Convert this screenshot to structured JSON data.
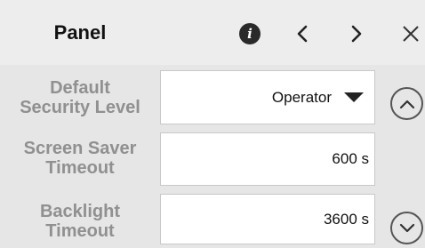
{
  "header": {
    "title": "Panel",
    "info_label": "i"
  },
  "settings": [
    {
      "label": "Default\nSecurity Level",
      "value": "Operator",
      "kind": "dropdown"
    },
    {
      "label": "Screen Saver\nTimeout",
      "value": "600 s",
      "kind": "text"
    },
    {
      "label": "Backlight\nTimeout",
      "value": "3600 s",
      "kind": "text"
    }
  ],
  "icons": {
    "info": "info-icon",
    "prev": "chevron-left-icon",
    "next": "chevron-right-icon",
    "close": "close-icon",
    "dropdown": "caret-down-icon",
    "scroll_up": "chevron-up-icon",
    "scroll_down": "chevron-down-icon"
  },
  "colors": {
    "header_bg": "#ededed",
    "panel_bg": "#e6e6e6",
    "label_text": "#909090",
    "field_bg": "#ffffff"
  }
}
